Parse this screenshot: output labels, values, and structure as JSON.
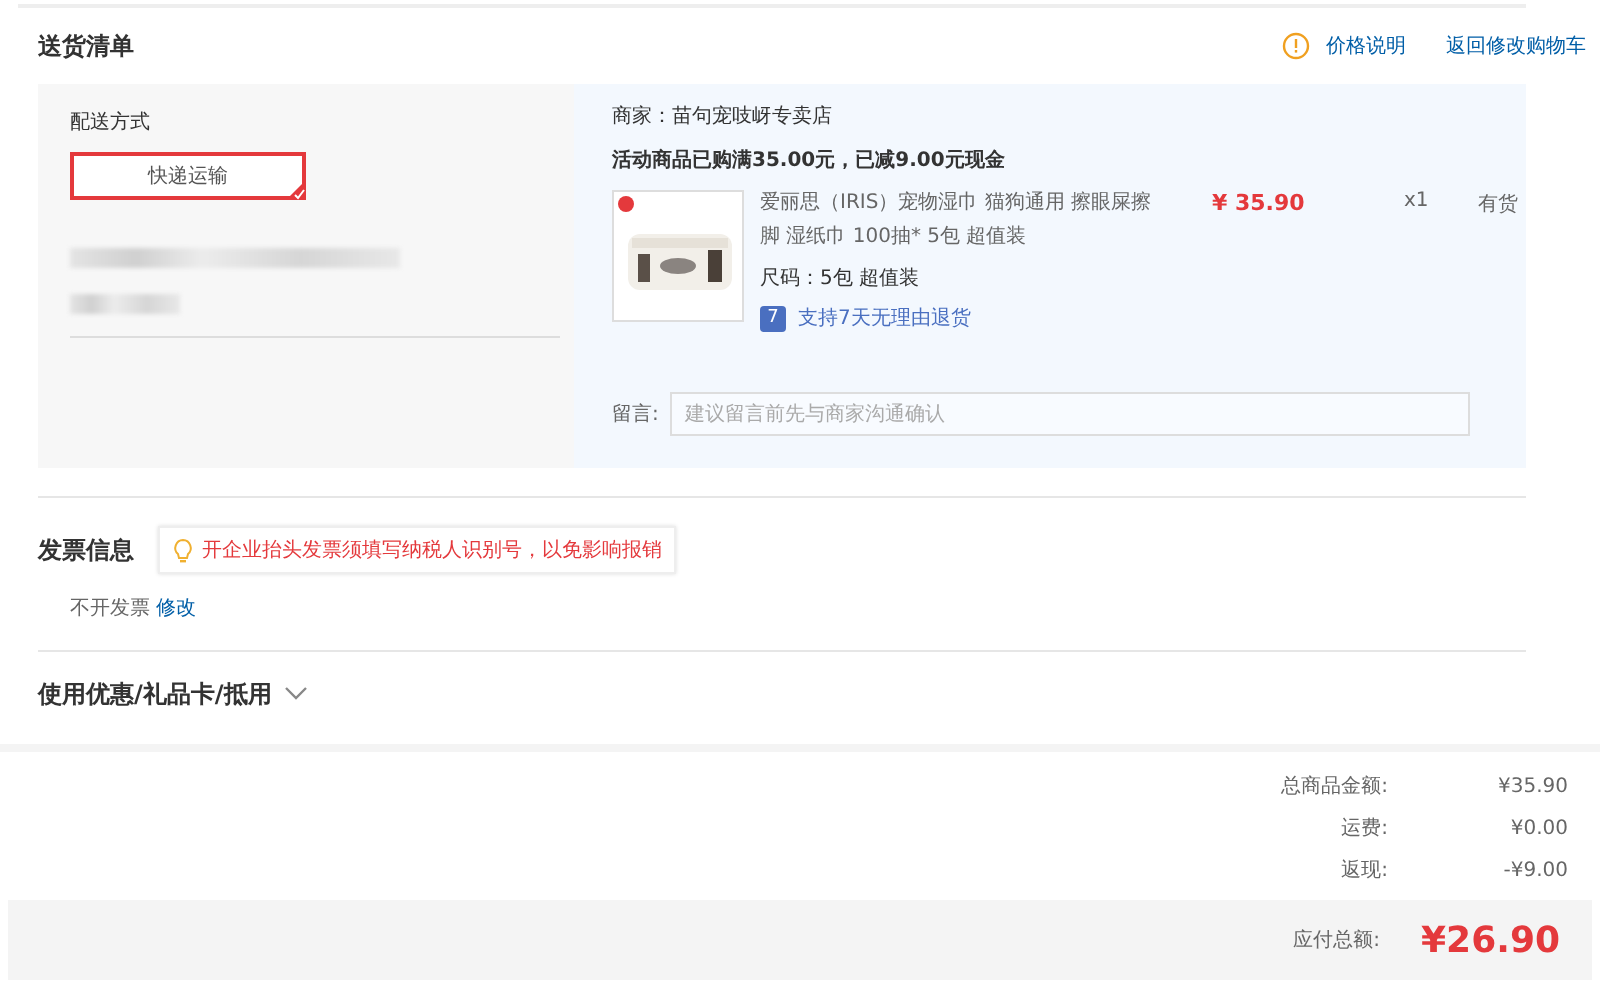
{
  "section_title": "送货清单",
  "header_links": [
    {
      "kind": "info",
      "label": "价格说明"
    },
    {
      "kind": "link",
      "label": "返回修改购物车"
    }
  ],
  "delivery": {
    "label": "配送方式",
    "options": [
      {
        "label": "快递运输",
        "selected": true
      }
    ]
  },
  "shop": {
    "seller": "商家：苗句宠吱岈专卖店",
    "promotion": "活动商品已购满35.00元，已减9.00元现金",
    "item": {
      "title": "爱丽思（IRIS）宠物湿巾 猫狗通用 擦眼屎擦脚 湿纸巾 100抽* 5包 超值装",
      "price": "¥ 35.90",
      "quantity": "x1",
      "stock": "有货",
      "spec": "尺码：5包 超值装",
      "return_badge": "7",
      "return_policy": "支持7天无理由退货"
    },
    "message": {
      "label": "留言:",
      "placeholder": "建议留言前先与商家沟通确认"
    }
  },
  "invoice": {
    "title": "发票信息",
    "tip": "开企业抬头发票须填写纳税人识别号，以免影响报销",
    "status": "不开发票",
    "edit_link": "修改"
  },
  "coupons": {
    "title": "使用优惠/礼品卡/抵用",
    "expanded": false
  },
  "summary": [
    {
      "label": "总商品金额:",
      "value": "¥35.90"
    },
    {
      "label": "运费:",
      "value": "¥0.00"
    },
    {
      "label": "返现:",
      "value": "-¥9.00"
    }
  ],
  "total": {
    "label": "应付总额:",
    "value": "¥26.90"
  }
}
